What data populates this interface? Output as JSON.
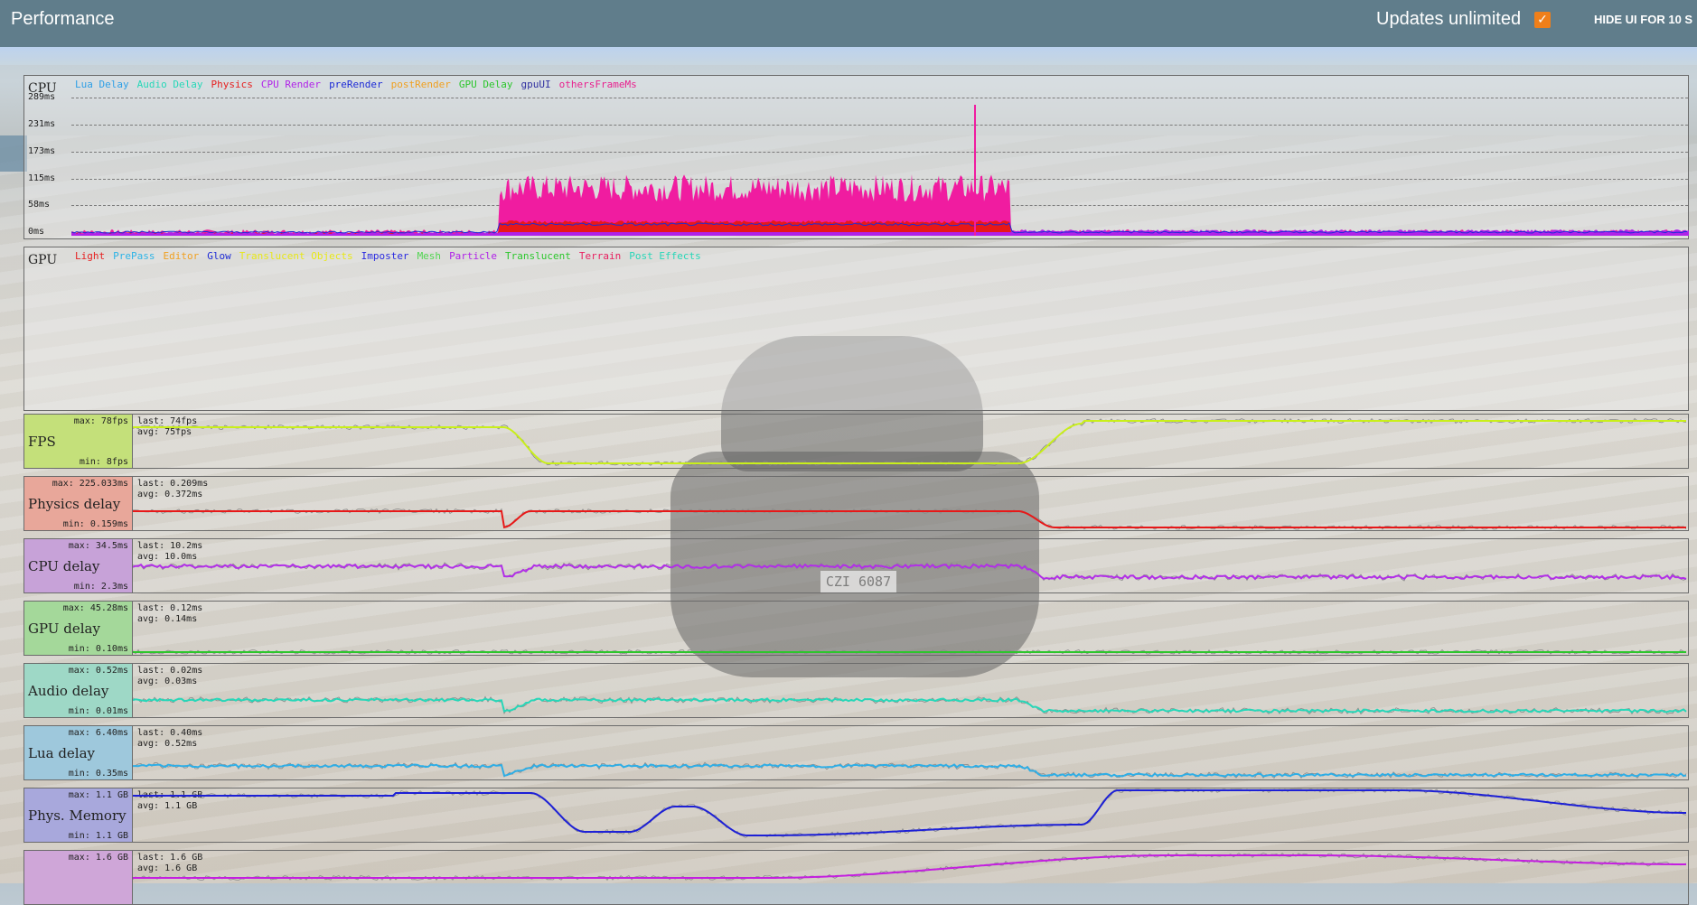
{
  "topbar": {
    "title": "Performance",
    "updates_label": "Updates unlimited",
    "updates_checked": true,
    "hide_label": "HIDE UI FOR 10 S"
  },
  "cpu": {
    "label": "CPU",
    "legend": [
      {
        "name": "Lua Delay",
        "color": "#2e9fe6"
      },
      {
        "name": "Audio Delay",
        "color": "#27d7b8"
      },
      {
        "name": "Physics",
        "color": "#e62020"
      },
      {
        "name": "CPU Render",
        "color": "#b022e8"
      },
      {
        "name": "preRender",
        "color": "#1d2bd6"
      },
      {
        "name": "postRender",
        "color": "#f0a020"
      },
      {
        "name": "GPU Delay",
        "color": "#2cc62c"
      },
      {
        "name": "gpuUI",
        "color": "#3030a0"
      },
      {
        "name": "othersFrameMs",
        "color": "#e8208e"
      }
    ],
    "ticks": [
      "289ms",
      "231ms",
      "173ms",
      "115ms",
      "58ms",
      "0ms"
    ]
  },
  "gpu": {
    "label": "GPU",
    "legend": [
      {
        "name": "Light",
        "color": "#e62020"
      },
      {
        "name": "PrePass",
        "color": "#2eb4e6"
      },
      {
        "name": "Editor",
        "color": "#f0a020"
      },
      {
        "name": "Glow",
        "color": "#1d2bd6"
      },
      {
        "name": "Translucent Objects",
        "color": "#e8e818"
      },
      {
        "name": "Imposter",
        "color": "#2a2ae0"
      },
      {
        "name": "Mesh",
        "color": "#52d652"
      },
      {
        "name": "Particle",
        "color": "#b022e8"
      },
      {
        "name": "Translucent",
        "color": "#2cc62c"
      },
      {
        "name": "Terrain",
        "color": "#e82060"
      },
      {
        "name": "Post Effects",
        "color": "#27d7b8"
      }
    ]
  },
  "metrics": [
    {
      "name": "FPS",
      "max": "max: 78fps",
      "min": "min: 8fps",
      "last": "last: 74fps",
      "avg": "avg: 75fps",
      "color": "#c9ef1a",
      "bg": "#c4e07a"
    },
    {
      "name": "Physics delay",
      "max": "max: 225.033ms",
      "min": "min: 0.159ms",
      "last": "last: 0.209ms",
      "avg": "avg: 0.372ms",
      "color": "#e81818",
      "bg": "#e8a79a"
    },
    {
      "name": "CPU delay",
      "max": "max: 34.5ms",
      "min": "min: 2.3ms",
      "last": "last: 10.2ms",
      "avg": "avg: 10.0ms",
      "color": "#b22ee8",
      "bg": "#c7a2d8"
    },
    {
      "name": "GPU delay",
      "max": "max: 45.28ms",
      "min": "min: 0.10ms",
      "last": "last: 0.12ms",
      "avg": "avg: 0.14ms",
      "color": "#2cc62c",
      "bg": "#a4d89a"
    },
    {
      "name": "Audio delay",
      "max": "max: 0.52ms",
      "min": "min: 0.01ms",
      "last": "last: 0.02ms",
      "avg": "avg: 0.03ms",
      "color": "#27d7b8",
      "bg": "#9ed8c6"
    },
    {
      "name": "Lua delay",
      "max": "max: 6.40ms",
      "min": "min: 0.35ms",
      "last": "last: 0.40ms",
      "avg": "avg: 0.52ms",
      "color": "#2eaee6",
      "bg": "#9ec8dc"
    },
    {
      "name": "Phys. Memory",
      "max": "max: 1.1 GB",
      "min": "min: 1.1 GB",
      "last": "last: 1.1 GB",
      "avg": "avg: 1.1 GB",
      "color": "#1d20d6",
      "bg": "#a8a8dc"
    },
    {
      "name": "",
      "max": "max: 1.6 GB",
      "min": "",
      "last": "last: 1.6 GB",
      "avg": "avg: 1.6 GB",
      "color": "#c41ee0",
      "bg": "#cfa6d8"
    }
  ],
  "scene": {
    "plate": "CZI 6087"
  }
}
